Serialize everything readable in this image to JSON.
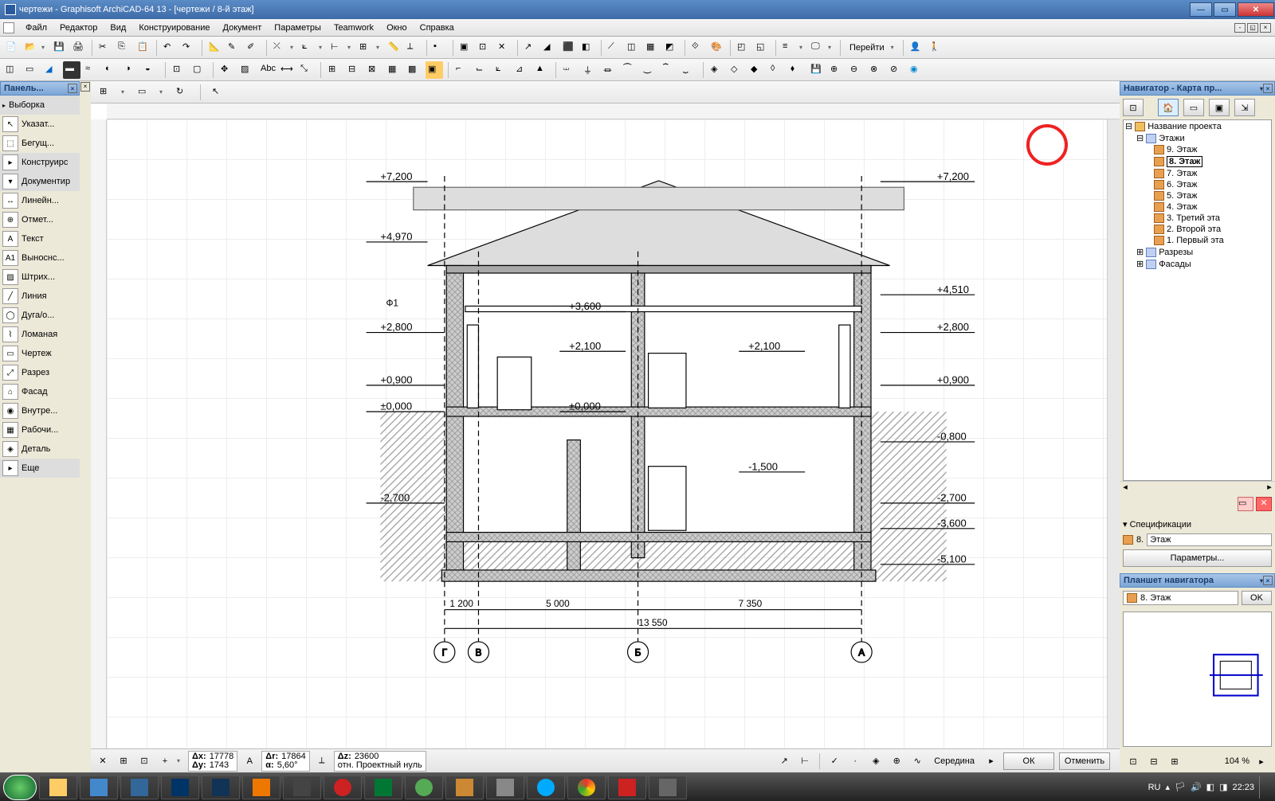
{
  "title": "чертежи - Graphisoft ArchiCAD-64 13 - [чертежи / 8-й этаж]",
  "menu": [
    "Файл",
    "Редактор",
    "Вид",
    "Конструирование",
    "Документ",
    "Параметры",
    "Teamwork",
    "Окно",
    "Справка"
  ],
  "toolbox": {
    "title": "Панель...",
    "selection": "Выборка",
    "items": [
      {
        "label": "Указат...",
        "ic": "↖"
      },
      {
        "label": "Бегущ...",
        "ic": "⬚"
      },
      {
        "label": "Конструирс",
        "group": true,
        "ic": "▸"
      },
      {
        "label": "Документир",
        "group": true,
        "ic": "▾"
      },
      {
        "label": "Линейн...",
        "ic": "↔"
      },
      {
        "label": "Отмет...",
        "ic": "⊕"
      },
      {
        "label": "Текст",
        "ic": "A"
      },
      {
        "label": "Выноснс...",
        "ic": "A1"
      },
      {
        "label": "Штрих...",
        "ic": "▨"
      },
      {
        "label": "Линия",
        "ic": "╱"
      },
      {
        "label": "Дуга/о...",
        "ic": "◯"
      },
      {
        "label": "Ломаная",
        "ic": "⌇"
      },
      {
        "label": "Чертеж",
        "ic": "▭"
      },
      {
        "label": "Разрез",
        "ic": "⤢"
      },
      {
        "label": "Фасад",
        "ic": "⌂"
      },
      {
        "label": "Внутре...",
        "ic": "◉"
      },
      {
        "label": "Рабочи...",
        "ic": "▦"
      },
      {
        "label": "Деталь",
        "ic": "◈"
      },
      {
        "label": "Еще",
        "group": true,
        "ic": "▸"
      }
    ]
  },
  "navigator": {
    "title": "Навигатор - Карта пр...",
    "root": "Название проекта",
    "stories_label": "Этажи",
    "stories": [
      "9. Этаж",
      "8. Этаж",
      "7. Этаж",
      "6. Этаж",
      "5. Этаж",
      "4. Этаж",
      "3. Третий эта",
      "2. Второй эта",
      "1. Первый эта"
    ],
    "selected_story": "8. Этаж",
    "sections": "Разрезы",
    "elevations": "Фасады"
  },
  "spec": {
    "title": "Спецификации",
    "num": "8.",
    "val": "Этаж",
    "params_btn": "Параметры..."
  },
  "planner": {
    "title": "Планшет навигатора",
    "val": "8. Этаж",
    "ok": "OK"
  },
  "status": {
    "dx": "17778",
    "dy": "1743",
    "dr": "17864",
    "da": "5,60°",
    "dz": "23600",
    "origin": "отн. Проектный нуль",
    "snap": "Середина",
    "zoom": "104 %",
    "ok": "ОК",
    "cancel": "Отменить"
  },
  "drawing": {
    "elevations_left": [
      "+7,200",
      "+4,970",
      "+2,800",
      "+0,900",
      "±0,000",
      "-2,700"
    ],
    "elevations_right": [
      "+7,200",
      "+4,510",
      "+2,800",
      "+0,900",
      "-0,800",
      "-2,700",
      "-3,600",
      "-5,100"
    ],
    "inner": [
      "+3,600",
      "+2,100",
      "+2,100",
      "±0,000",
      "-1,500"
    ],
    "phi": "Ф1",
    "dims": {
      "d1": "1 200",
      "d2": "5 000",
      "d3": "7 350",
      "total": "13 550"
    },
    "axes": [
      "Г",
      "В",
      "Б",
      "А"
    ]
  },
  "systray": {
    "lang": "RU",
    "time": "22:23"
  }
}
